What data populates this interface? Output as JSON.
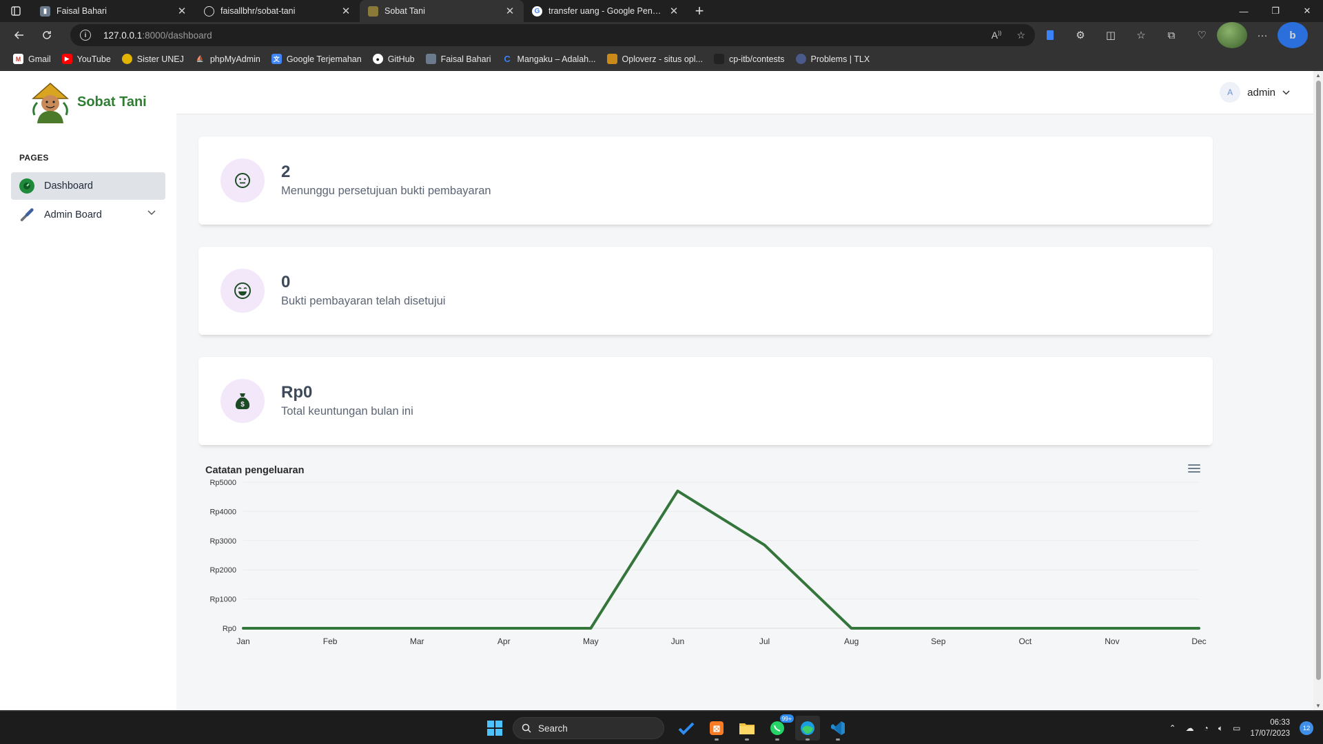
{
  "browser": {
    "tabs": [
      {
        "title": "Faisal Bahari",
        "active": false
      },
      {
        "title": "faisallbhr/sobat-tani",
        "active": false
      },
      {
        "title": "Sobat Tani",
        "active": true
      },
      {
        "title": "transfer uang - Google Penelusuran",
        "active": false
      }
    ],
    "url_host": "127.0.0.1",
    "url_path": ":8000/dashboard",
    "bookmarks": [
      {
        "label": "Gmail",
        "icon": "gmail-icon"
      },
      {
        "label": "YouTube",
        "icon": "youtube-icon"
      },
      {
        "label": "Sister UNEJ",
        "icon": "unej-icon"
      },
      {
        "label": "phpMyAdmin",
        "icon": "phpmyadmin-icon"
      },
      {
        "label": "Google Terjemahan",
        "icon": "translate-icon"
      },
      {
        "label": "GitHub",
        "icon": "github-icon"
      },
      {
        "label": "Faisal Bahari",
        "icon": "profile-icon"
      },
      {
        "label": "Mangaku – Adalah...",
        "icon": "mangaku-icon"
      },
      {
        "label": "Oploverz - situs opl...",
        "icon": "oploverz-icon"
      },
      {
        "label": "cp-itb/contests",
        "icon": "cpitb-icon"
      },
      {
        "label": "Problems | TLX",
        "icon": "tlx-icon"
      }
    ]
  },
  "app": {
    "brand": "Sobat Tani",
    "sidebar": {
      "section_label": "PAGES",
      "items": [
        {
          "label": "Dashboard",
          "active": true
        },
        {
          "label": "Admin Board",
          "active": false
        }
      ]
    },
    "user": {
      "initial": "A",
      "name": "admin"
    },
    "cards": [
      {
        "value": "2",
        "label": "Menunggu persetujuan bukti pembayaran",
        "icon": "neutral-face-icon"
      },
      {
        "value": "0",
        "label": "Bukti pembayaran telah disetujui",
        "icon": "grinning-face-icon"
      },
      {
        "value": "Rp0",
        "label": "Total keuntungan bulan ini",
        "icon": "money-bag-icon"
      }
    ]
  },
  "chart_data": {
    "type": "line",
    "title": "Catatan pengeluaran",
    "categories": [
      "Jan",
      "Feb",
      "Mar",
      "Apr",
      "May",
      "Jun",
      "Jul",
      "Aug",
      "Sep",
      "Oct",
      "Nov",
      "Dec"
    ],
    "series": [
      {
        "values": [
          0,
          0,
          0,
          0,
          0,
          4700,
          2850,
          0,
          0,
          0,
          0,
          0
        ]
      }
    ],
    "yticks": [
      "Rp0",
      "Rp1000",
      "Rp2000",
      "Rp3000",
      "Rp4000",
      "Rp5000"
    ],
    "ylim": [
      0,
      5000
    ],
    "grid": true,
    "color": "#33753a"
  },
  "taskbar": {
    "search_placeholder": "Search",
    "whatsapp_badge": "99+",
    "time": "06:33",
    "date": "17/07/2023",
    "notifications": "12"
  }
}
